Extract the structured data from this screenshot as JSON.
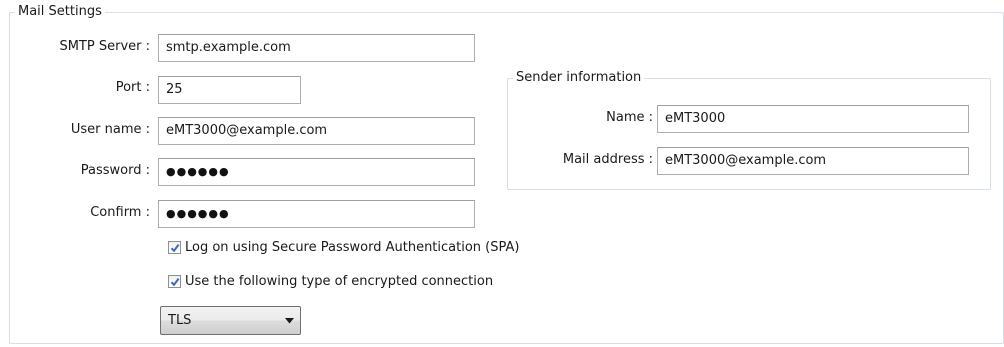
{
  "mail_settings": {
    "legend": "Mail Settings",
    "smtp_server": {
      "label": "SMTP Server :",
      "value": "smtp.example.com"
    },
    "port": {
      "label": "Port :",
      "value": "25"
    },
    "user_name": {
      "label": "User name :",
      "value": "eMT3000@example.com"
    },
    "password": {
      "label": "Password :",
      "value": "●●●●●●"
    },
    "confirm": {
      "label": "Confirm :",
      "value": "●●●●●●"
    },
    "spa_checkbox": {
      "label": "Log on using Secure Password Authentication (SPA)",
      "checked": true
    },
    "encryption_checkbox": {
      "label": "Use the following type of encrypted connection",
      "checked": true
    },
    "encryption_type": {
      "selected": "TLS"
    }
  },
  "sender_information": {
    "legend": "Sender information",
    "name": {
      "label": "Name :",
      "value": "eMT3000"
    },
    "mail_address": {
      "label": "Mail address :",
      "value": "eMT3000@example.com"
    }
  },
  "colors": {
    "group_border": "#d5dfe5",
    "checkmark": "#3c6cb4",
    "field_border": "#abadb3"
  },
  "icons": {
    "checkmark": "checkmark-icon",
    "dropdown_arrow": "chevron-down-icon"
  }
}
